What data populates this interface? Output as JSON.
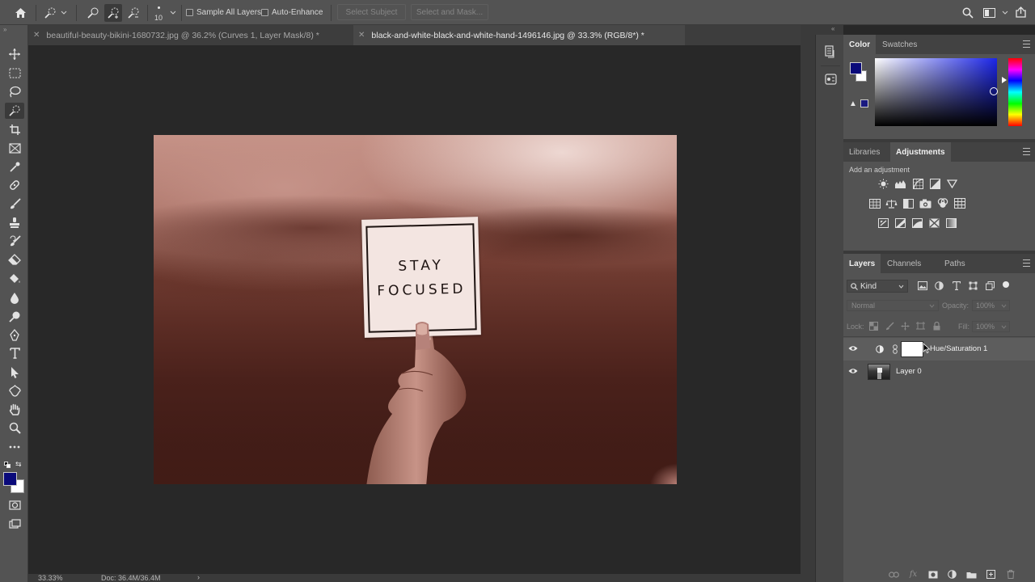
{
  "options_bar": {
    "brush_size": "10",
    "sample_all_layers": "Sample All Layers",
    "auto_enhance": "Auto-Enhance",
    "select_subject": "Select Subject",
    "select_and_mask": "Select and Mask..."
  },
  "tabs": [
    {
      "title": "beautiful-beauty-bikini-1680732.jpg @ 36.2% (Curves 1, Layer Mask/8) *",
      "active": false
    },
    {
      "title": "black-and-white-black-and-white-hand-1496146.jpg @ 33.3% (RGB/8*) *",
      "active": true
    }
  ],
  "image": {
    "note_line1": "STAY",
    "note_line2": "FOCUSED"
  },
  "status_bar": {
    "zoom": "33.33%",
    "doc": "Doc: 36.4M/36.4M",
    "arrow": "›"
  },
  "color_panel": {
    "tabs": [
      "Color",
      "Swatches"
    ],
    "foreground": "#0a0a7a",
    "background": "#ffffff"
  },
  "adjustments_panel": {
    "tabs": [
      "Libraries",
      "Adjustments"
    ],
    "hint": "Add an adjustment"
  },
  "layers_panel": {
    "tabs": [
      "Layers",
      "Channels",
      "Paths"
    ],
    "filter_kind": "Kind",
    "blend_mode": "Normal",
    "opacity_label": "Opacity:",
    "opacity_value": "100%",
    "lock_label": "Lock:",
    "fill_label": "Fill:",
    "fill_value": "100%",
    "layers": [
      {
        "name": "Hue/Saturation 1"
      },
      {
        "name": "Layer 0"
      }
    ]
  },
  "colors": {
    "accent_blue": "#2f6fd1",
    "foreground": "#0a0a7a"
  }
}
